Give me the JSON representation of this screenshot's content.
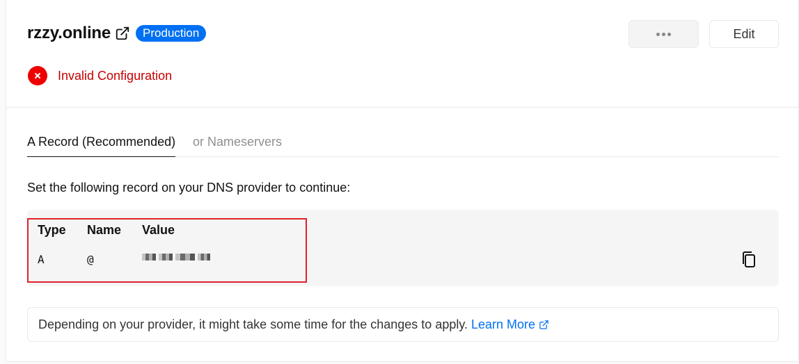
{
  "domain": {
    "name": "rzzy.online",
    "environment_badge": "Production",
    "status": "Invalid Configuration"
  },
  "actions": {
    "more_icon": "ellipsis-icon",
    "edit_label": "Edit"
  },
  "tabs": [
    {
      "label": "A Record (Recommended)",
      "active": true
    },
    {
      "label": "or Nameservers",
      "active": false
    }
  ],
  "instructions": "Set the following record on your DNS provider to continue:",
  "record": {
    "headers": [
      "Type",
      "Name",
      "Value"
    ],
    "type": "A",
    "name": "@",
    "value_redacted": true
  },
  "note": {
    "text": "Depending on your provider, it might take some time for the changes to apply.",
    "link_label": "Learn More"
  },
  "colors": {
    "accent": "#0070f3",
    "error": "#e00000",
    "highlight_border": "#e0222b"
  }
}
